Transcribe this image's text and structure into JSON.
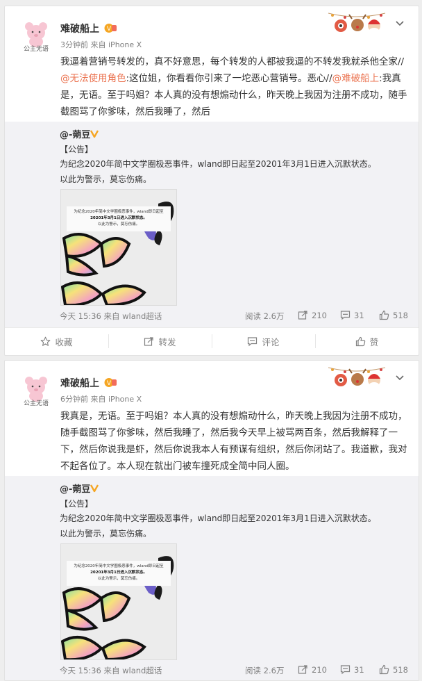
{
  "posts": [
    {
      "author": "难破船上",
      "avatar_caption": "公主无语",
      "time": "3分钟前",
      "source_prefix": "来自",
      "source": "iPhone X",
      "text": [
        {
          "t": "我逼着营销号转发的，真不好意思，每个转发的人都被我逼的不转发我就杀他全家//"
        },
        {
          "t": "@无法使用角色",
          "mention": true
        },
        {
          "t": ":这位姐，你看看你引来了一坨恶心营销号。恶心//"
        },
        {
          "t": "@难破船上",
          "mention": true
        },
        {
          "t": ":我真是，无语。至于吗姐？本人真的没有想煽动什么，昨天晚上我因为注册不成功，随手截图骂了你爹味，然后我睡了，然后"
        }
      ],
      "repost": {
        "author": "@-蒴豆",
        "lines": [
          "【公告】",
          "为纪念2020年简中文学圈极恶事件，wland即日起至20201年3月1日进入沉默状态。",
          "以此为警示，莫忘伤痛。"
        ],
        "image_caption": [
          "为纪念2020年简中文学圈极恶事件，wland即日起至",
          "20201年3月1日进入沉默状态。",
          "以此为警示，莫忘伤痛。"
        ],
        "time": "今天 15:36",
        "source_prefix": "来自",
        "source": "wland超话",
        "reads_label": "阅读 2.6万",
        "reposts": "210",
        "comments": "31",
        "likes": "518"
      },
      "actions": {
        "favorite": "收藏",
        "repost": "转发",
        "comment": "评论",
        "like": "赞"
      }
    },
    {
      "author": "难破船上",
      "avatar_caption": "公主无语",
      "time": "6分钟前",
      "source_prefix": "来自",
      "source": "iPhone X",
      "text": [
        {
          "t": "我真是，无语。至于吗姐？本人真的没有想煽动什么，昨天晚上我因为注册不成功，随手截图骂了你爹味，然后我睡了，然后我今天早上被骂两百条，然后我解释了一下，然后你说我是虾，然后你说我本人有预谋有组织，然后你闭站了。我道歉，我对不起各位了。本人现在就出门被车撞死成全简中同人圈。"
        }
      ],
      "repost": {
        "author": "@-蒴豆",
        "lines": [
          "【公告】",
          "为纪念2020年简中文学圈极恶事件，wland即日起至20201年3月1日进入沉默状态。",
          "以此为警示，莫忘伤痛。"
        ],
        "image_caption": [
          "为纪念2020年简中文学圈极恶事件，wland即日起至",
          "20201年3月1日进入沉默状态。",
          "以此为警示，莫忘伤痛。"
        ],
        "time": "今天 15:36",
        "source_prefix": "来自",
        "source": "wland超话",
        "reads_label": "阅读 2.6万",
        "reposts": "210",
        "comments": "31",
        "likes": "518"
      }
    }
  ],
  "colors": {
    "mention": "#eb7350",
    "repost_bg": "#f2f2f5",
    "vip_gold": "#f5a623"
  },
  "icons": [
    "star-icon",
    "repost-icon",
    "comment-icon",
    "like-icon",
    "chevron-down-icon",
    "vip-badge-icon",
    "gold-v-icon"
  ]
}
